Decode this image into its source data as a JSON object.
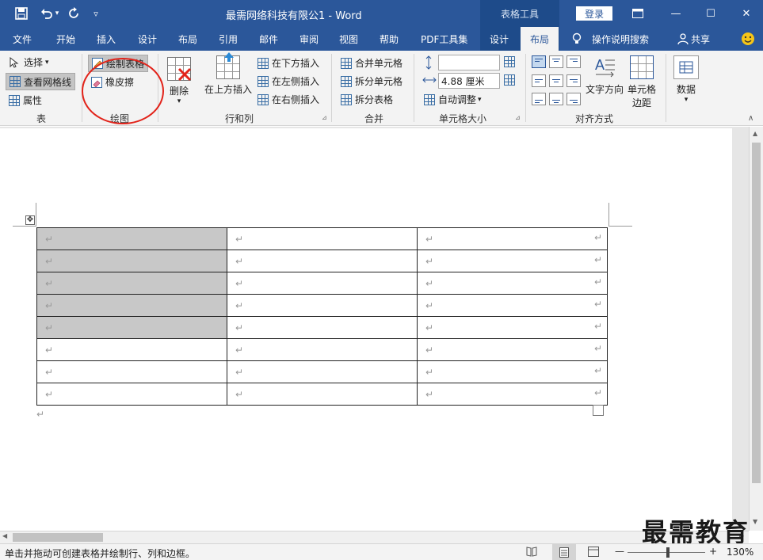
{
  "titlebar": {
    "title": "最需网络科技有限公1 - Word",
    "context_tab": "表格工具",
    "login": "登录",
    "restore_icon": "ribbon-display-icon",
    "min": "—",
    "max": "☐",
    "close": "✕"
  },
  "tabs": [
    "文件",
    "开始",
    "插入",
    "设计",
    "布局",
    "引用",
    "邮件",
    "审阅",
    "视图",
    "帮助",
    "PDF工具集",
    "设计",
    "布局"
  ],
  "active_tab": "布局",
  "tellme": "操作说明搜索",
  "share": "共享",
  "ribbon": {
    "table_group": {
      "label": "表",
      "select": "选择",
      "view_gridlines": "查看网格线",
      "properties": "属性"
    },
    "draw_group": {
      "label": "绘图",
      "draw_table": "绘制表格",
      "eraser": "橡皮擦"
    },
    "rows_cols_group": {
      "label": "行和列",
      "delete": "删除",
      "insert_above": "在上方插入",
      "insert_below": "在下方插入",
      "insert_left": "在左侧插入",
      "insert_right": "在右侧插入"
    },
    "merge_group": {
      "label": "合并",
      "merge_cells": "合并单元格",
      "split_cells": "拆分单元格",
      "split_table": "拆分表格"
    },
    "cell_size_group": {
      "label": "单元格大小",
      "height_value": "",
      "width_value": "4.88 厘米",
      "autofit": "自动调整"
    },
    "alignment_group": {
      "label": "对齐方式",
      "text_direction": "文字方向",
      "cell_margins_1": "单元格",
      "cell_margins_2": "边距"
    },
    "data_group": {
      "label": "数据"
    }
  },
  "document": {
    "para_mark": "↵",
    "rows": 8,
    "cols": 3,
    "shaded_rows": 5
  },
  "status": {
    "hint": "单击并拖动可创建表格并绘制行、列和边框。",
    "zoom": "130%",
    "minus": "—",
    "plus": "+"
  },
  "watermark": "最需教育",
  "colors": {
    "accent": "#2b579a",
    "highlight_circle": "#e2231a",
    "shade": "#c8c8c8"
  }
}
